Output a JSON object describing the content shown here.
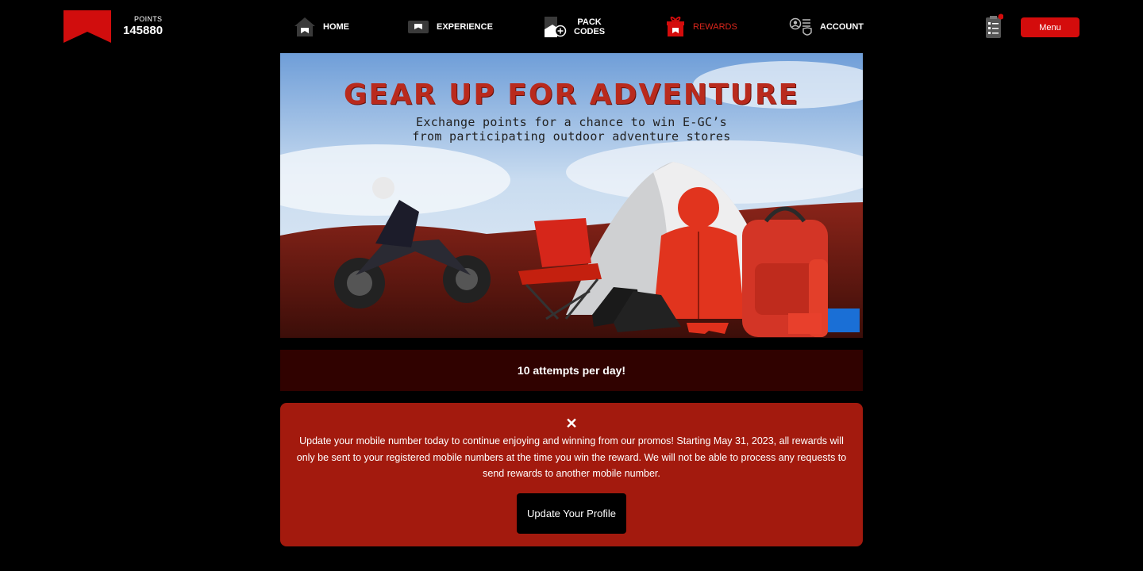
{
  "header": {
    "points_label": "POINTS",
    "points_value": "145880",
    "nav": [
      {
        "label": "HOME",
        "icon": "house-icon"
      },
      {
        "label": "EXPERIENCE",
        "icon": "window-icon"
      },
      {
        "label_line1": "PACK",
        "label_line2": "CODES",
        "icon": "pack-add-icon"
      },
      {
        "label": "REWARDS",
        "icon": "gift-icon",
        "active": true
      },
      {
        "label": "ACCOUNT",
        "icon": "account-icon"
      }
    ],
    "menu_label": "Menu",
    "accent_color": "#d40c0c"
  },
  "banner": {
    "title": "GEAR UP FOR ADVENTURE",
    "subtitle_line1": "Exchange points for a chance to win E-GC’s",
    "subtitle_line2": "from participating outdoor adventure stores"
  },
  "attempts": {
    "text": "10 attempts per day!"
  },
  "notice": {
    "close_symbol": "✕",
    "message": "Update your mobile number today to continue enjoying and winning from our promos! Starting May 31, 2023, all rewards will only be sent to your registered mobile numbers at the time you win the reward. We will not be able to process any requests to send rewards to another mobile number.",
    "button_label": "Update Your Profile",
    "background_color": "#a31a0e"
  }
}
